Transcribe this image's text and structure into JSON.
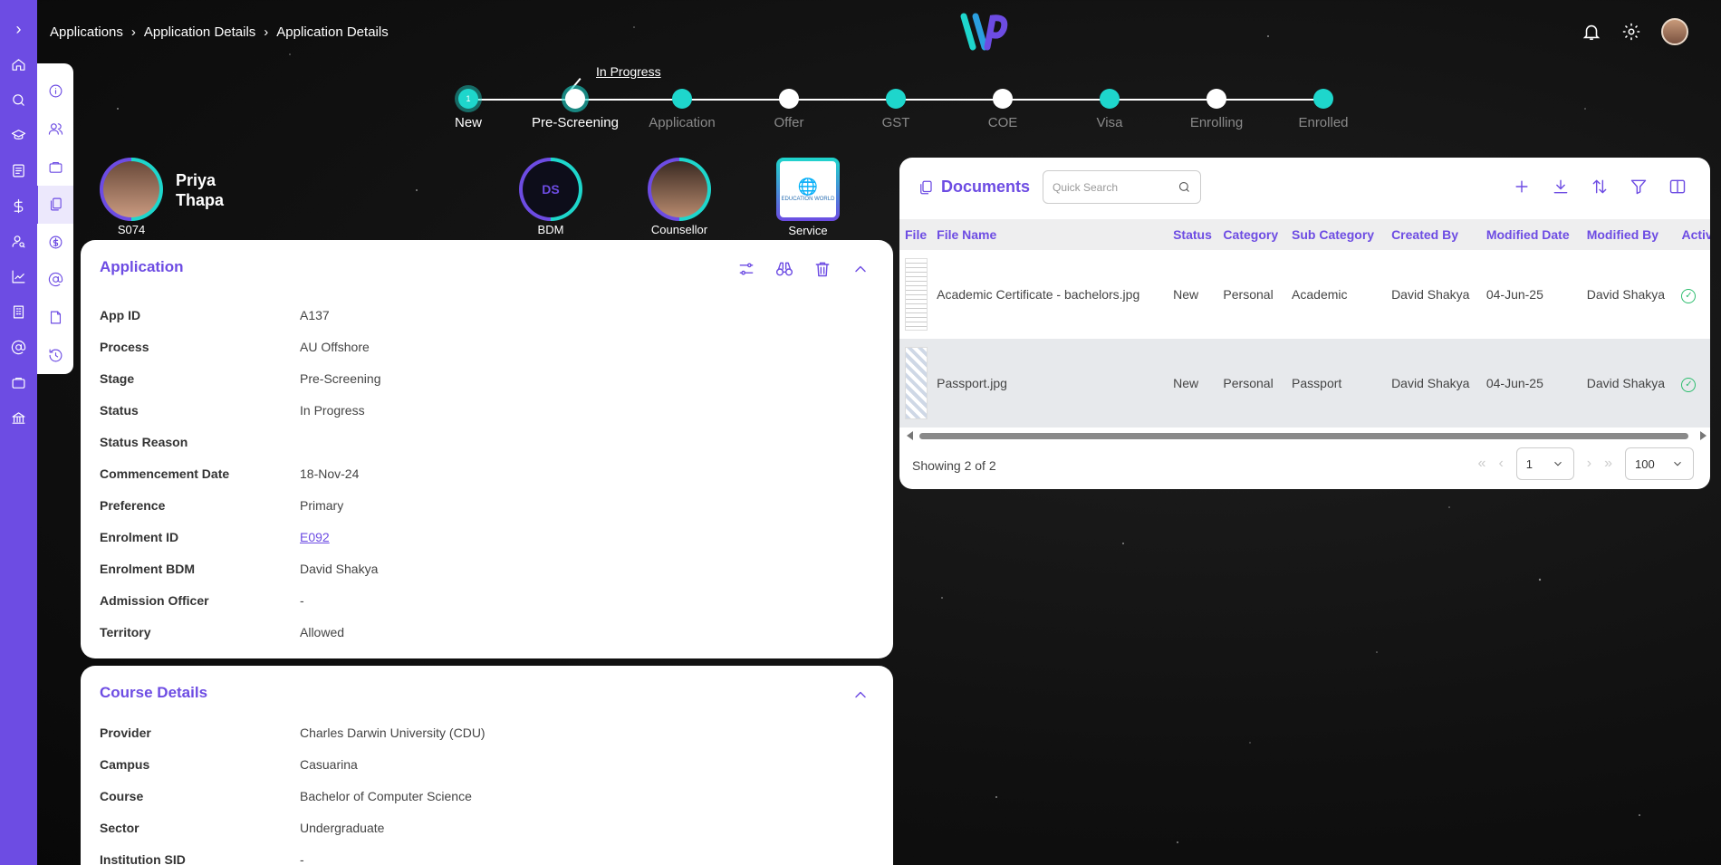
{
  "breadcrumb": [
    "Applications",
    "Application Details",
    "Application Details"
  ],
  "stepper": {
    "current_status": "In Progress",
    "first_step_number": "1",
    "steps": [
      {
        "label": "New",
        "state": "done"
      },
      {
        "label": "Pre-Screening",
        "state": "current"
      },
      {
        "label": "Application",
        "state": "pending"
      },
      {
        "label": "Offer",
        "state": "pending"
      },
      {
        "label": "GST",
        "state": "pending"
      },
      {
        "label": "COE",
        "state": "pending"
      },
      {
        "label": "Visa",
        "state": "pending"
      },
      {
        "label": "Enrolling",
        "state": "pending"
      },
      {
        "label": "Enrolled",
        "state": "pending"
      }
    ]
  },
  "student": {
    "first_name": "Priya",
    "last_name": "Thapa",
    "id": "S074"
  },
  "bdm_logo_text": "DS",
  "service_partner_logo_text": "EDUCATION WORLD",
  "people": {
    "bdm": "BDM",
    "counsellor": "Counsellor",
    "service_partner": "Service Partner"
  },
  "application": {
    "title": "Application",
    "fields": [
      {
        "label": "App ID",
        "value": "A137"
      },
      {
        "label": "Process",
        "value": "AU Offshore"
      },
      {
        "label": "Stage",
        "value": "Pre-Screening"
      },
      {
        "label": "Status",
        "value": "In Progress"
      },
      {
        "label": "Status Reason",
        "value": ""
      },
      {
        "label": "Commencement Date",
        "value": "18-Nov-24"
      },
      {
        "label": "Preference",
        "value": "Primary"
      },
      {
        "label": "Enrolment ID",
        "value": "E092"
      },
      {
        "label": "Enrolment BDM",
        "value": "David Shakya"
      },
      {
        "label": "Admission Officer",
        "value": "-"
      },
      {
        "label": "Territory",
        "value": "Allowed"
      }
    ]
  },
  "course": {
    "title": "Course Details",
    "fields": [
      {
        "label": "Provider",
        "value": "Charles Darwin University (CDU)"
      },
      {
        "label": "Campus",
        "value": "Casuarina"
      },
      {
        "label": "Course",
        "value": "Bachelor of Computer Science"
      },
      {
        "label": "Sector",
        "value": "Undergraduate"
      },
      {
        "label": "Institution SID",
        "value": "-"
      }
    ]
  },
  "documents": {
    "title": "Documents",
    "search_placeholder": "Quick Search",
    "columns": [
      "File",
      "File Name",
      "Status",
      "Category",
      "Sub Category",
      "Created By",
      "Modified Date",
      "Modified By",
      "Active"
    ],
    "rows": [
      {
        "file_name": "Academic Certificate - bachelors.jpg",
        "status": "New",
        "category": "Personal",
        "sub_category": "Academic",
        "created_by": "David Shakya",
        "modified_date": "04-Jun-25",
        "modified_by": "David Shakya"
      },
      {
        "file_name": "Passport.jpg",
        "status": "New",
        "category": "Personal",
        "sub_category": "Passport",
        "created_by": "David Shakya",
        "modified_date": "04-Jun-25",
        "modified_by": "David Shakya"
      }
    ],
    "showing": "Showing 2 of 2",
    "page": "1",
    "page_size": "100"
  },
  "colors": {
    "accent": "#6d4ce3",
    "teal": "#1ed6cc",
    "success": "#2dbd6e"
  }
}
